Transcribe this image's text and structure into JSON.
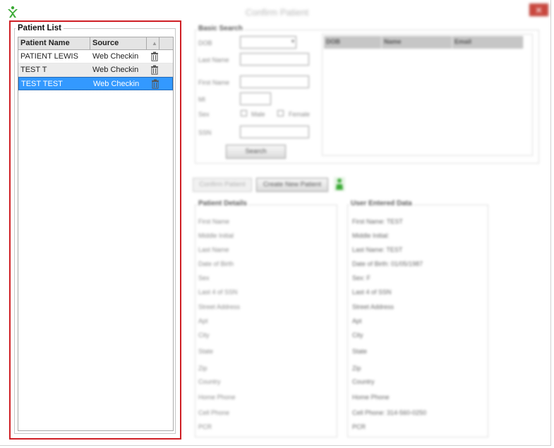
{
  "window": {
    "title": "Confirm Patient",
    "close_glyph": "✕",
    "app_icon": "green-x-logo-icon"
  },
  "patient_list": {
    "group_title": "Patient List",
    "columns": [
      "Patient Name",
      "Source",
      ""
    ],
    "rows": [
      {
        "name": "PATIENT LEWIS",
        "source": "Web Checkin"
      },
      {
        "name": "TEST T",
        "source": "Web Checkin"
      },
      {
        "name": "TEST TEST",
        "source": "Web Checkin"
      }
    ],
    "selected_index": 2,
    "row_icon": "trash-icon"
  },
  "basic_search": {
    "title": "Basic Search",
    "labels": {
      "dob": "DOB",
      "last_name": "Last Name",
      "first_name": "First Name",
      "mi": "MI",
      "sex": "Sex",
      "male": "Male",
      "female": "Female",
      "ssn": "SSN"
    },
    "search_button": "Search",
    "results_columns": [
      "DOB",
      "Name",
      "Email"
    ]
  },
  "actions": {
    "confirm_button": "Confirm Patient",
    "create_button": "Create New Patient",
    "indicator_icon": "green-person-icon"
  },
  "patient_details": {
    "title": "Patient Details",
    "fields": [
      "First Name",
      "Middle Initial",
      "Last Name",
      "Date of Birth",
      "Sex",
      "Last 4 of SSN",
      "Street Address",
      "Apt",
      "City",
      "State",
      "Zip",
      "Country",
      "Home Phone",
      "Cell Phone",
      "PCR"
    ]
  },
  "user_entered": {
    "title": "User Entered Data",
    "fields": [
      "First Name: TEST",
      "Middle Initial:",
      "Last Name: TEST",
      "Date of Birth: 01/05/1987",
      "Sex: F",
      "Last 4 of SSN",
      "Street Address",
      "Apt",
      "City",
      "State",
      "Zip",
      "Country",
      "Home Phone",
      "Cell Phone: 314-560-0250",
      "PCR"
    ]
  }
}
